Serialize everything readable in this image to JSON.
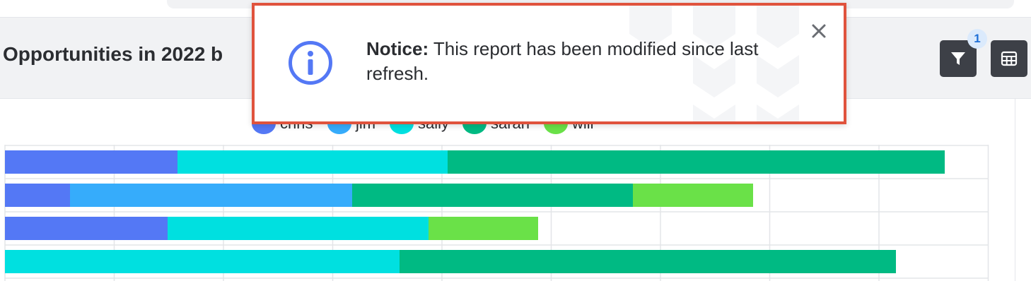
{
  "header": {
    "title": "Opportunities in 2022 b",
    "filter_badge_count": "1",
    "filter_button": "filter-icon",
    "grid_button": "grid-icon"
  },
  "notice": {
    "label": "Notice:",
    "message": "This report has been modified since last refresh.",
    "icon": "info-icon",
    "close_icon": "close-icon",
    "border_color": "#e0533d"
  },
  "chart_data": {
    "type": "bar",
    "orientation": "horizontal",
    "stacked": true,
    "legend_position": "top",
    "grid": true,
    "series": [
      {
        "name": "chris",
        "color": "#5478f5"
      },
      {
        "name": "jim",
        "color": "#36acfb"
      },
      {
        "name": "sally",
        "color": "#00e0e0"
      },
      {
        "name": "sarah",
        "color": "#00ba83"
      },
      {
        "name": "will",
        "color": "#6ae148"
      }
    ],
    "rows": [
      {
        "chris": 244,
        "jim": 0,
        "sally": 382,
        "sarah": 703,
        "will": 0
      },
      {
        "chris": 92,
        "jim": 399,
        "sally": 0,
        "sarah": 397,
        "will": 170
      },
      {
        "chris": 230,
        "jim": 0,
        "sally": 369,
        "sarah": 0,
        "will": 155
      },
      {
        "chris": 0,
        "jim": 0,
        "sally": 558,
        "sarah": 702,
        "will": 0
      }
    ]
  }
}
